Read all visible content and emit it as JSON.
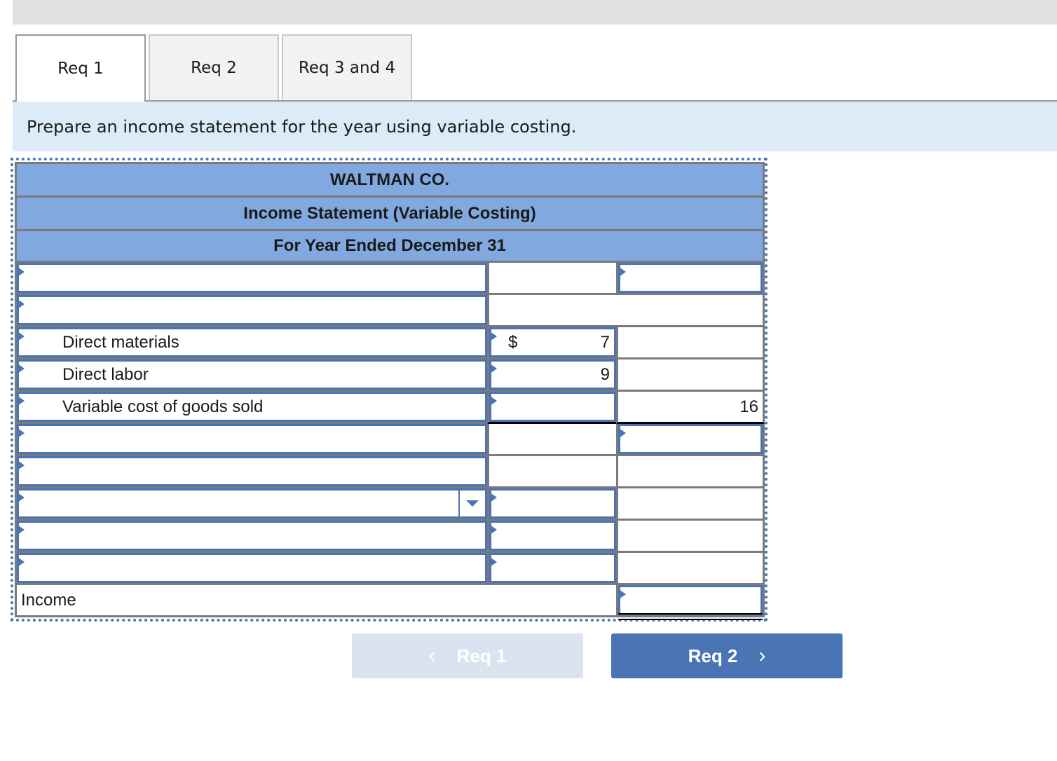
{
  "tabs": [
    {
      "label": "Req 1",
      "active": true
    },
    {
      "label": "Req 2",
      "active": false
    },
    {
      "label": "Req 3 and 4",
      "active": false
    }
  ],
  "instruction": "Prepare an income statement for the year using variable costing.",
  "statement": {
    "company": "WALTMAN CO.",
    "title": "Income Statement (Variable Costing)",
    "period": "For Year Ended December 31",
    "rows": [
      {
        "label": "",
        "mid": "",
        "right": ""
      },
      {
        "label": "",
        "mid": "",
        "right": ""
      },
      {
        "label": "Direct materials",
        "currency": "$",
        "mid": "7",
        "right": ""
      },
      {
        "label": "Direct labor",
        "mid": "9",
        "right": ""
      },
      {
        "label": "Variable cost of goods sold",
        "mid": "",
        "right": "16"
      },
      {
        "label": "",
        "mid": "",
        "right": ""
      },
      {
        "label": "",
        "mid": "",
        "right": ""
      },
      {
        "label": "",
        "dropdown_value": "",
        "mid": "",
        "right": ""
      },
      {
        "label": "",
        "mid": "",
        "right": ""
      },
      {
        "label": "",
        "mid": "",
        "right": ""
      }
    ],
    "final_label": "Income",
    "final_value": ""
  },
  "nav": {
    "prev_label": "Req 1",
    "next_label": "Req 2",
    "prev_icon": "chevron-left-icon",
    "next_icon": "chevron-right-icon"
  },
  "colors": {
    "header_blue": "#81a9df",
    "input_border": "#4a74b4",
    "instruction_bg": "#ddeaf7",
    "next_button": "#4a74b4",
    "prev_button_disabled": "#dae3ef"
  }
}
